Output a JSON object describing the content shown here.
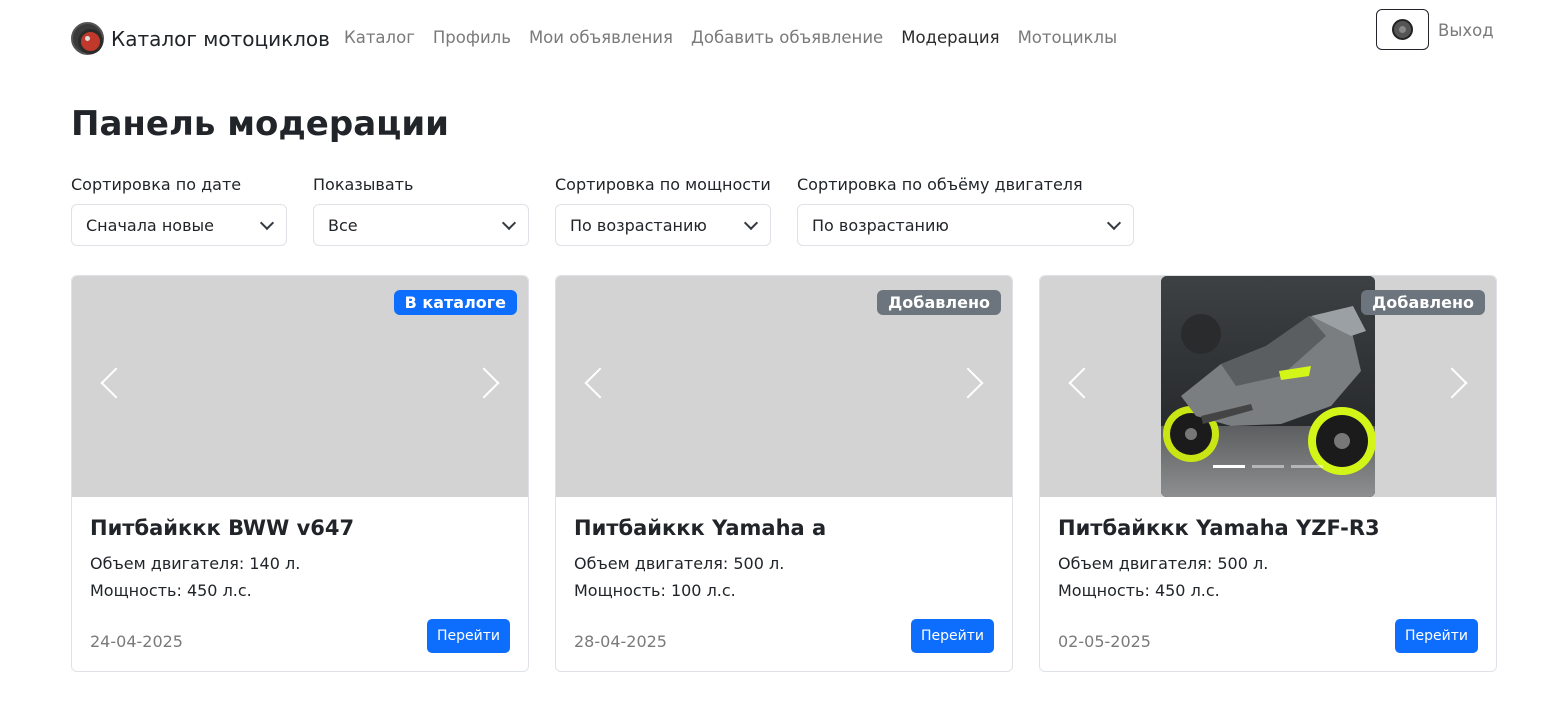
{
  "header": {
    "brand": "Каталог мотоциклов",
    "nav": [
      {
        "label": "Каталог"
      },
      {
        "label": "Профиль"
      },
      {
        "label": "Мои объявления"
      },
      {
        "label": "Добавить объявление"
      },
      {
        "label": "Модерация",
        "active": true
      },
      {
        "label": "Мотоциклы"
      }
    ],
    "logout": "Выход"
  },
  "page": {
    "title": "Панель модерации"
  },
  "filters": [
    {
      "label": "Сортировка по дате",
      "value": "Сначала новые"
    },
    {
      "label": "Показывать",
      "value": "Все"
    },
    {
      "label": "Сортировка по мощности",
      "value": "По возрастанию"
    },
    {
      "label": "Сортировка по объёму двигателя",
      "value": "По возрастанию"
    }
  ],
  "cards": [
    {
      "badge": "В каталоге",
      "badge_color": "#0d6efd",
      "title": "Питбайккк BWW v647",
      "engine": "Объем двигателя: 140 л.",
      "power": "Мощность: 450 л.с.",
      "date": "24-04-2025",
      "button": "Перейти"
    },
    {
      "badge": "Добавлено",
      "badge_color": "#6c757d",
      "title": "Питбайккк Yamaha a",
      "engine": "Объем двигателя: 500 л.",
      "power": "Мощность: 100 л.с.",
      "date": "28-04-2025",
      "button": "Перейти"
    },
    {
      "badge": "Добавлено",
      "badge_color": "#6c757d",
      "title": "Питбайккк Yamaha YZF-R3",
      "engine": "Объем двигателя: 500 л.",
      "power": "Мощность: 450 л.с.",
      "date": "02-05-2025",
      "button": "Перейти",
      "has_photo": true,
      "slides": 3,
      "active_slide": 0
    }
  ],
  "colors": {
    "primary": "#0d6efd",
    "secondary": "#6c757d",
    "placeholder": "#d3d3d3",
    "accent_yellow": "#d4f518"
  }
}
